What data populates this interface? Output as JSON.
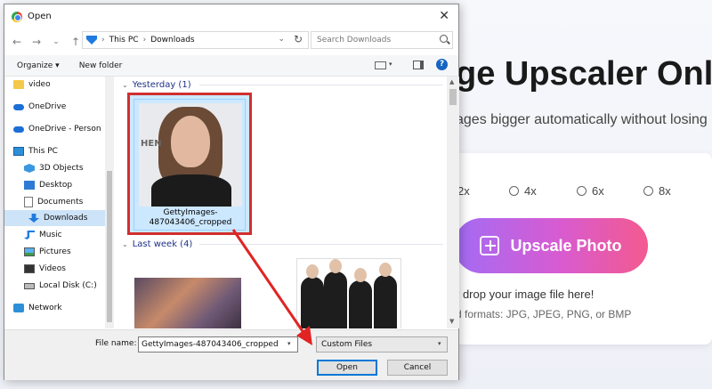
{
  "background": {
    "heading": "ge Upscaler Onl",
    "subtitle": "ages bigger automatically without losing",
    "scale_options": [
      "2x",
      "4x",
      "6x",
      "8x"
    ],
    "upscale_button": "Upscale Photo",
    "drop_text": "r drop your image file here!",
    "formats_text": "d formats: JPG, JPEG, PNG, or BMP"
  },
  "dialog": {
    "title": "Open",
    "close": "✕",
    "nav": {
      "back": "←",
      "forward": "→",
      "recent": "⌄",
      "up": "↑"
    },
    "breadcrumb": [
      "This PC",
      "Downloads"
    ],
    "search_placeholder": "Search Downloads",
    "commands": {
      "organize": "Organize ▾",
      "new_folder": "New folder"
    },
    "sidebar": [
      {
        "label": "video",
        "icon": "folder-icon"
      },
      {
        "label": "OneDrive",
        "icon": "cloud-icon"
      },
      {
        "label": "OneDrive - Person",
        "icon": "cloud-icon"
      },
      {
        "label": "This PC",
        "icon": "pc-icon"
      },
      {
        "label": "3D Objects",
        "icon": "3d-objects-icon"
      },
      {
        "label": "Desktop",
        "icon": "desktop-icon"
      },
      {
        "label": "Documents",
        "icon": "documents-icon"
      },
      {
        "label": "Downloads",
        "icon": "downloads-icon",
        "selected": true
      },
      {
        "label": "Music",
        "icon": "music-icon"
      },
      {
        "label": "Pictures",
        "icon": "pictures-icon"
      },
      {
        "label": "Videos",
        "icon": "videos-icon"
      },
      {
        "label": "Local Disk (C:)",
        "icon": "disk-icon"
      },
      {
        "label": "Network",
        "icon": "network-icon"
      }
    ],
    "groups": [
      {
        "label": "Yesterday (1)"
      },
      {
        "label": "Last week (4)"
      }
    ],
    "selected_file": {
      "name": "GettyImages-487043406_cropped",
      "thumb_text": "HEN"
    },
    "file_name_label": "File name:",
    "file_name_value": "GettyImages-487043406_cropped",
    "file_type": "Custom Files",
    "open_button": "Open",
    "cancel_button": "Cancel"
  },
  "colors": {
    "highlight_red": "#d12f2f",
    "selection_blue": "#cce8ff",
    "group_header": "#1e3287"
  }
}
